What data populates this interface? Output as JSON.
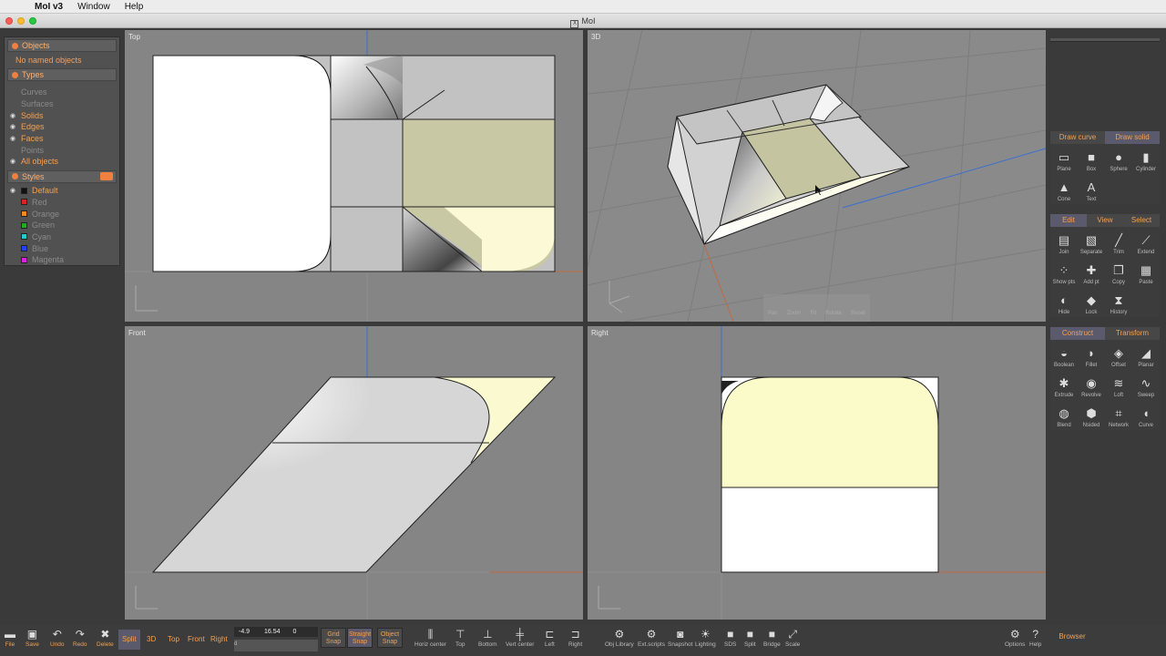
{
  "menubar": {
    "app": "MoI v3",
    "items": [
      "Window",
      "Help"
    ]
  },
  "window": {
    "title": "MoI"
  },
  "leftpanel": {
    "objects_header": "Objects",
    "no_named": "No named objects",
    "types_header": "Types",
    "types": [
      {
        "label": "Curves",
        "state": "dim"
      },
      {
        "label": "Surfaces",
        "state": "dim"
      },
      {
        "label": "Solids",
        "state": "on"
      },
      {
        "label": "Edges",
        "state": "on"
      },
      {
        "label": "Faces",
        "state": "on"
      },
      {
        "label": "Points",
        "state": "dim"
      },
      {
        "label": "All objects",
        "state": "on"
      }
    ],
    "styles_header": "Styles",
    "styles": [
      {
        "label": "Default",
        "color": "#111111",
        "state": "on"
      },
      {
        "label": "Red",
        "color": "#dd2222",
        "state": "dim"
      },
      {
        "label": "Orange",
        "color": "#f08a20",
        "state": "dim"
      },
      {
        "label": "Green",
        "color": "#22aa22",
        "state": "dim"
      },
      {
        "label": "Cyan",
        "color": "#22cccc",
        "state": "dim"
      },
      {
        "label": "Blue",
        "color": "#2244ee",
        "state": "dim"
      },
      {
        "label": "Magenta",
        "color": "#dd22dd",
        "state": "dim"
      }
    ]
  },
  "viewports": {
    "top": "Top",
    "three_d": "3D",
    "front": "Front",
    "right": "Right"
  },
  "rightpanel": {
    "draw_tabs": [
      "Draw curve",
      "Draw solid"
    ],
    "draw_tools": [
      {
        "label": "Plane",
        "icon": "plane-icon"
      },
      {
        "label": "Box",
        "icon": "box-icon"
      },
      {
        "label": "Sphere",
        "icon": "sphere-icon"
      },
      {
        "label": "Cylinder",
        "icon": "cylinder-icon"
      },
      {
        "label": "Cone",
        "icon": "cone-icon"
      },
      {
        "label": "Text",
        "icon": "text-icon"
      }
    ],
    "edit_tabs": [
      "Edit",
      "View",
      "Select"
    ],
    "edit_tools": [
      {
        "label": "Join",
        "icon": "join-icon"
      },
      {
        "label": "Separate",
        "icon": "separate-icon"
      },
      {
        "label": "Trim",
        "icon": "trim-icon"
      },
      {
        "label": "Extend",
        "icon": "extend-icon"
      },
      {
        "label": "Show pts",
        "icon": "show-points-icon"
      },
      {
        "label": "Add pt",
        "icon": "add-point-icon"
      },
      {
        "label": "Copy",
        "icon": "copy-icon"
      },
      {
        "label": "Paste",
        "icon": "paste-icon"
      },
      {
        "label": "Hide",
        "icon": "hide-icon"
      },
      {
        "label": "Lock",
        "icon": "lock-icon"
      },
      {
        "label": "History",
        "icon": "history-icon"
      }
    ],
    "construct_tabs": [
      "Construct",
      "Transform"
    ],
    "construct_tools": [
      {
        "label": "Boolean",
        "icon": "boolean-icon"
      },
      {
        "label": "Fillet",
        "icon": "fillet-icon"
      },
      {
        "label": "Offset",
        "icon": "offset-icon"
      },
      {
        "label": "Planar",
        "icon": "planar-icon"
      },
      {
        "label": "Extrude",
        "icon": "extrude-icon"
      },
      {
        "label": "Revolve",
        "icon": "revolve-icon"
      },
      {
        "label": "Loft",
        "icon": "loft-icon"
      },
      {
        "label": "Sweep",
        "icon": "sweep-icon"
      },
      {
        "label": "Blend",
        "icon": "blend-icon"
      },
      {
        "label": "Nsided",
        "icon": "nsided-icon"
      },
      {
        "label": "Network",
        "icon": "network-icon"
      },
      {
        "label": "Curve",
        "icon": "curve-icon"
      }
    ],
    "browser": "Browser"
  },
  "viewnav": [
    "Pan",
    "Zoom",
    "Fit",
    "Rotate",
    "Reset"
  ],
  "bottombar": {
    "file": "File",
    "save": "Save",
    "undo": "Undo",
    "redo": "Redo",
    "delete": "Delete",
    "views": [
      "Split",
      "3D",
      "Top",
      "Front",
      "Right"
    ],
    "coord_x": "-4.9",
    "coord_y": "16.54",
    "coord_z": "0",
    "coord_d": "d",
    "grid_snap": [
      "Grid",
      "Snap"
    ],
    "straight_snap": [
      "Straight",
      "Snap"
    ],
    "object_snap": [
      "Object",
      "Snap"
    ],
    "align": [
      "Horiz center",
      "Top",
      "Bottom",
      "Vert center",
      "Left",
      "Right"
    ],
    "extras": [
      "Obj Library",
      "Ext.scripts",
      "Snapshot",
      "Lighting",
      "SDS",
      "Split",
      "Bridge",
      "Scale"
    ],
    "options": "Options",
    "help": "Help"
  }
}
